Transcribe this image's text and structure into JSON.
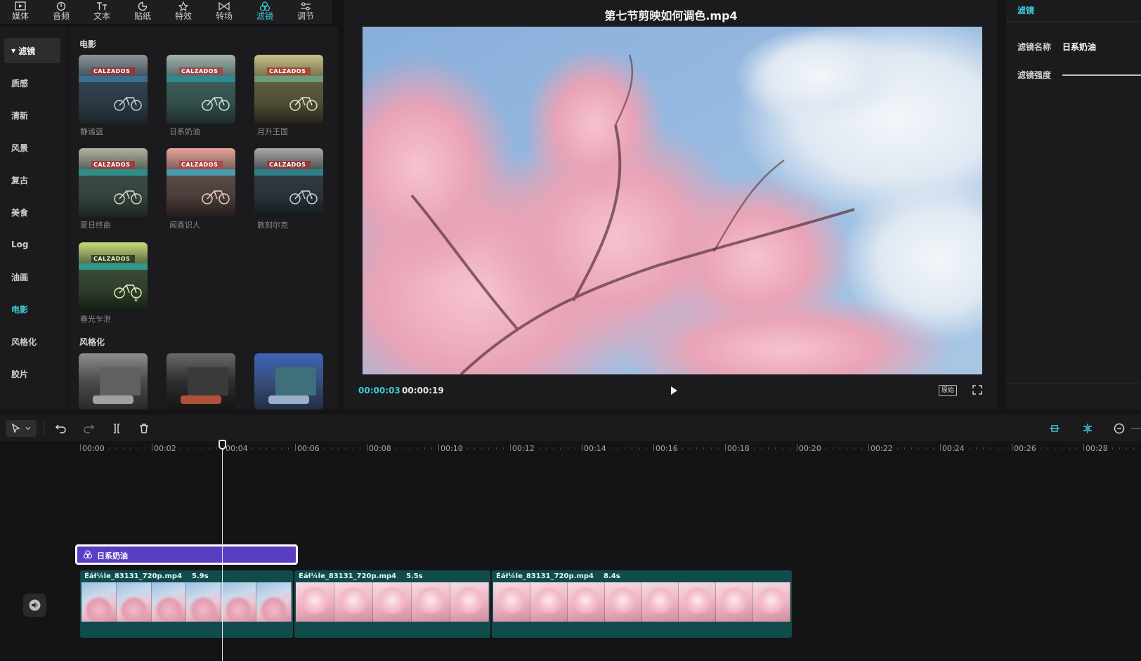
{
  "toolbar": {
    "items": [
      {
        "label": "媒体",
        "icon": "media-icon"
      },
      {
        "label": "音频",
        "icon": "audio-icon"
      },
      {
        "label": "文本",
        "icon": "text-icon"
      },
      {
        "label": "贴纸",
        "icon": "sticker-icon"
      },
      {
        "label": "特效",
        "icon": "effects-icon"
      },
      {
        "label": "转场",
        "icon": "transition-icon"
      },
      {
        "label": "滤镜",
        "icon": "filter-icon",
        "active": true
      },
      {
        "label": "调节",
        "icon": "adjust-icon"
      }
    ]
  },
  "categories": {
    "items": [
      {
        "label": "滤镜",
        "selected": true
      },
      {
        "label": "质感"
      },
      {
        "label": "清新"
      },
      {
        "label": "风景"
      },
      {
        "label": "复古"
      },
      {
        "label": "美食"
      },
      {
        "label": "Log"
      },
      {
        "label": "油画"
      },
      {
        "label": "电影",
        "active": true
      },
      {
        "label": "风格化"
      },
      {
        "label": "胶片"
      }
    ]
  },
  "filters": {
    "section_movie": "电影",
    "section_stylized": "风格化",
    "thumb_sign_text": "CALZADOS",
    "movie_items": [
      {
        "label": "静谧蓝"
      },
      {
        "label": "日系奶油"
      },
      {
        "label": "月升王国"
      },
      {
        "label": "夏日终曲"
      },
      {
        "label": "闻香识人"
      },
      {
        "label": "敦刻尔克"
      },
      {
        "label": "春光乍泄"
      }
    ]
  },
  "preview": {
    "title": "第七节剪映如何调色.mp4",
    "time_current": "00:00:03",
    "time_total": "00:00:19",
    "ratio_label": "原始"
  },
  "properties": {
    "tab": "滤镜",
    "name_key": "滤镜名称",
    "name_value": "日系奶油",
    "strength_key": "滤镜强度"
  },
  "timeline": {
    "ruler": [
      "00:00",
      "00:02",
      "00:04",
      "00:06",
      "00:08",
      "00:10",
      "00:12",
      "00:14",
      "00:16",
      "00:18",
      "00:20",
      "00:22",
      "00:24",
      "00:26",
      "00:28"
    ],
    "filter_clip_label": "日系奶油",
    "clips": [
      {
        "name": "Éáł¼le_83131_720p.mp4",
        "duration": "5.9s"
      },
      {
        "name": "Éáł¼le_83131_720p.mp4",
        "duration": "5.5s"
      },
      {
        "name": "Éáł¼le_83131_720p.mp4",
        "duration": "8.4s"
      }
    ]
  },
  "colors": {
    "accent": "#3ccbd4",
    "filter_clip": "#5b3cc4",
    "video_clip": "#104c4c"
  }
}
